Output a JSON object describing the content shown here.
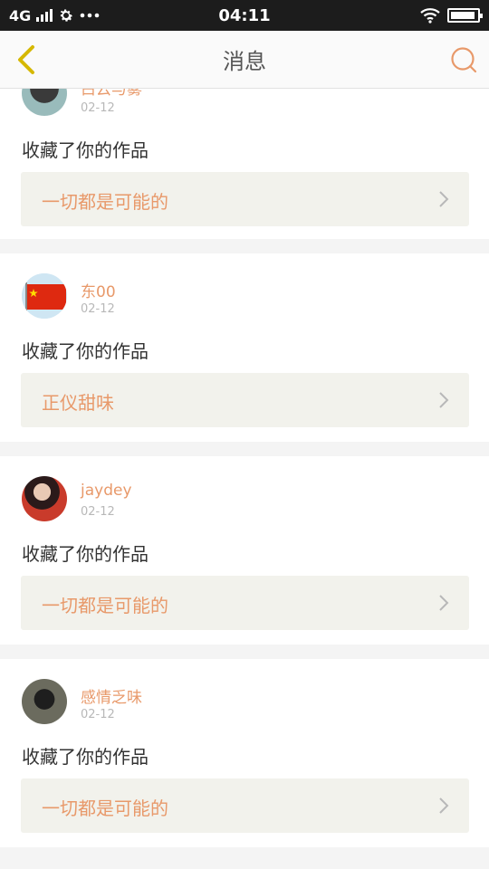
{
  "status_bar": {
    "network": "4G",
    "settings_icon": "gear-icon",
    "more_icon": "more-dots-icon",
    "time": "04:11",
    "wifi_icon": "wifi-icon",
    "battery_icon": "battery-icon",
    "battery_level": 0.92
  },
  "header": {
    "title": "消息",
    "back_icon": "chevron-left-icon",
    "search_icon": "search-icon",
    "accent_color": "#e8996a",
    "back_color": "#d6b800"
  },
  "messages": [
    {
      "username": "白云与雾",
      "date": "02-12",
      "action": "收藏了你的作品",
      "work_title": "一切都是可能的"
    },
    {
      "username": "东00",
      "date": "02-12",
      "action": "收藏了你的作品",
      "work_title": "正仪甜味"
    },
    {
      "username": "jaydey",
      "date": "02-12",
      "action": "收藏了你的作品",
      "work_title": "一切都是可能的"
    },
    {
      "username": "感情乏味",
      "date": "02-12",
      "action": "收藏了你的作品",
      "work_title": "一切都是可能的"
    }
  ]
}
